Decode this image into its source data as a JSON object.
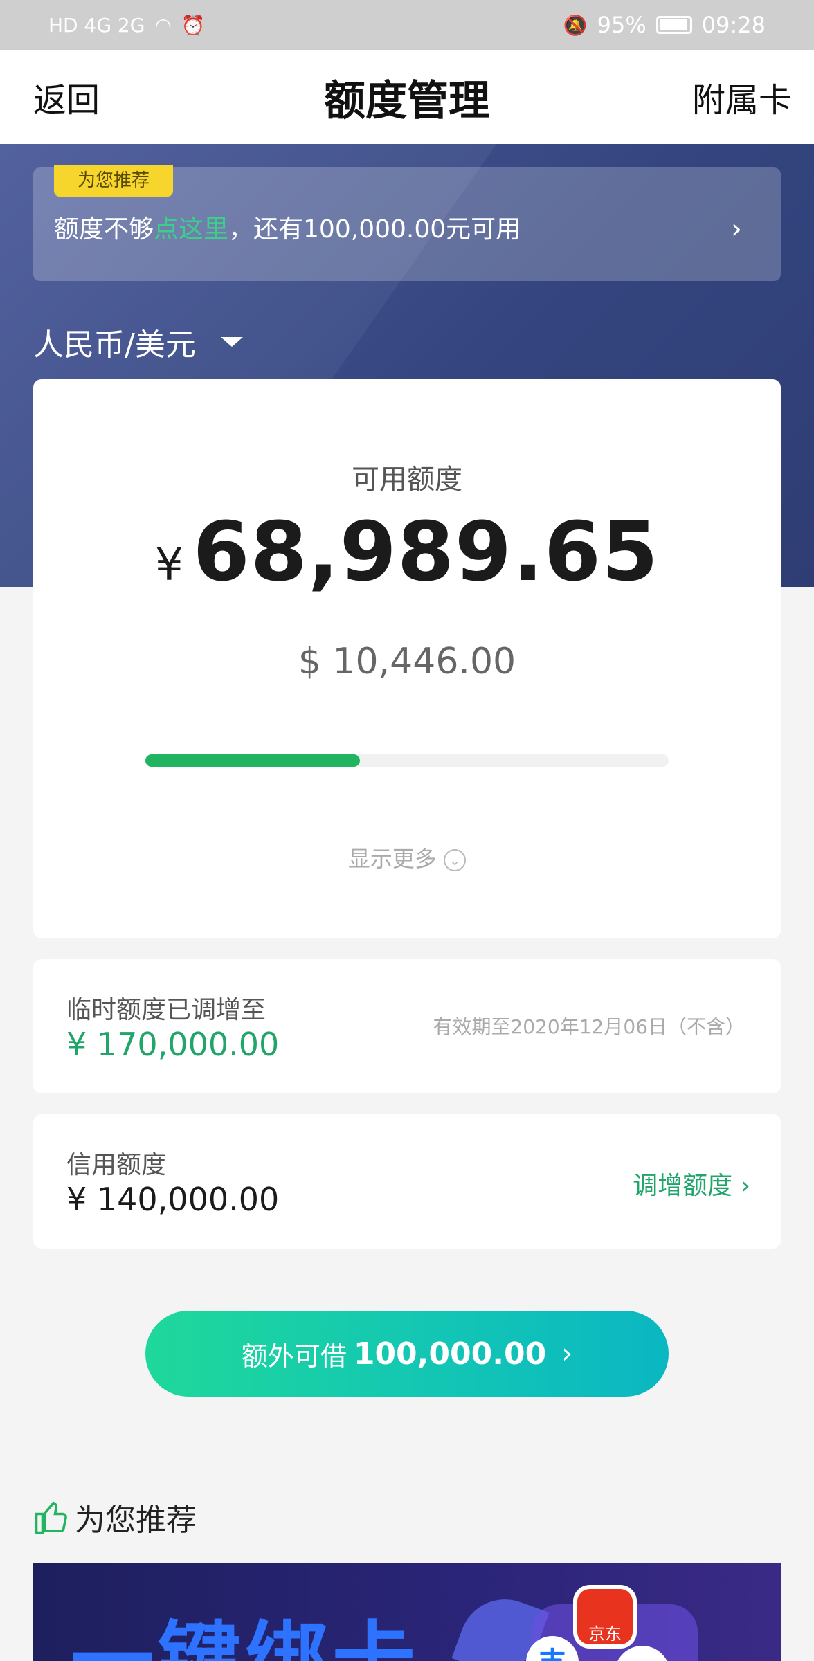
{
  "status_bar": {
    "left_icons": "HD 4G 2G",
    "battery": "95%",
    "time": "09:28"
  },
  "nav": {
    "back": "返回",
    "title": "额度管理",
    "right": "附属卡"
  },
  "promo": {
    "tag": "为您推荐",
    "text_before": "额度不够",
    "text_link": "点这里",
    "text_after": "，还有100,000.00元可用",
    "arrow": "›"
  },
  "currency_selector": {
    "value": "人民币/美元"
  },
  "available": {
    "label": "可用额度",
    "currency_symbol": "¥",
    "amount": "68,989.65",
    "usd": "$ 10,446.00",
    "progress_fraction": 0.41,
    "progress_color": "#22b561",
    "show_more": "显示更多"
  },
  "temp_limit": {
    "label": "临时额度已调增至",
    "amount": "¥ 170,000.00",
    "validity": "有效期至2020年12月06日（不含）"
  },
  "credit_limit": {
    "label": "信用额度",
    "amount": "¥ 140,000.00",
    "link": "调增额度 ›"
  },
  "cta": {
    "prefix": "额外可借",
    "amount": "100,000.00",
    "arrow": "›"
  },
  "recommend": {
    "title": "为您推荐",
    "icon": "thumbs-up-icon"
  },
  "banner": {
    "headline": "一键绑卡",
    "jd_label": "京东",
    "alipay_label": "支"
  },
  "colors": {
    "accent_green": "#22a56a",
    "header_blue": "#34457f",
    "tag_yellow": "#f6d52c"
  }
}
